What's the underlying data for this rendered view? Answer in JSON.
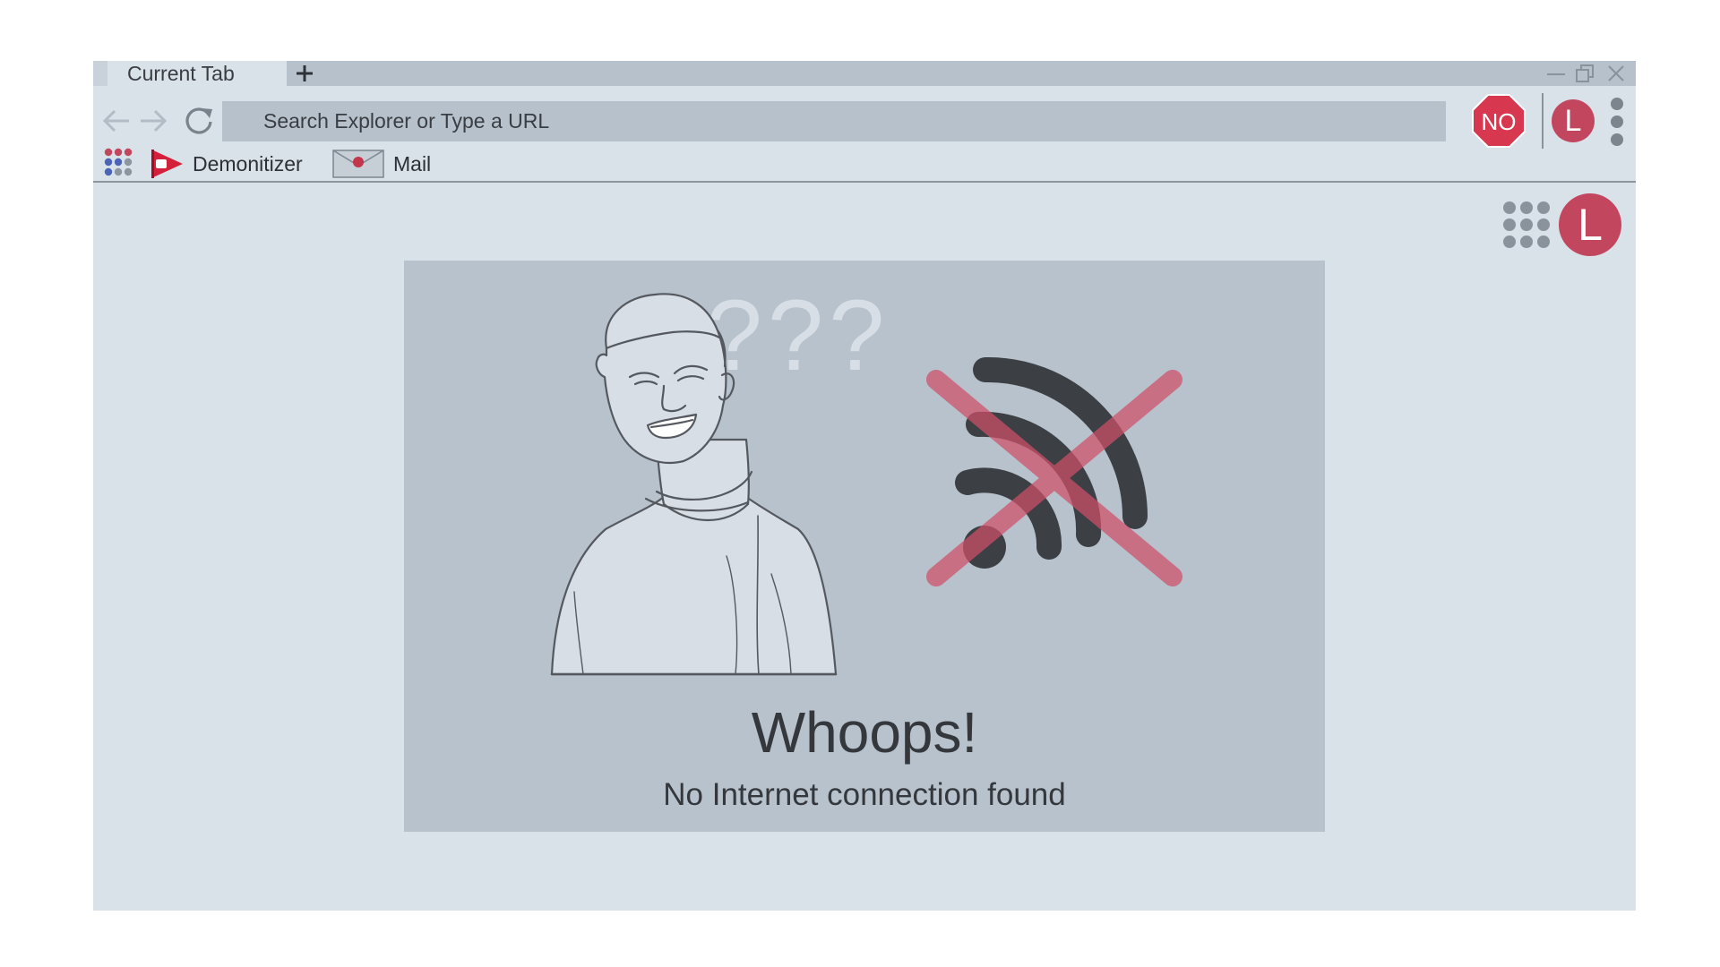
{
  "tabs": [
    {
      "label": "Current Tab",
      "active": true
    }
  ],
  "new_tab_label": "+",
  "toolbar": {
    "address_placeholder": "Search Explorer or Type a URL",
    "extension_badge": "NO",
    "profile_initial": "L"
  },
  "bookmarks": [
    {
      "label": "Demonitizer",
      "icon": "red-flag-play-icon"
    },
    {
      "label": "Mail",
      "icon": "envelope-icon"
    }
  ],
  "page": {
    "profile_initial": "L",
    "question_marks": "???",
    "error_title": "Whoops!",
    "error_message": "No Internet connection found"
  },
  "colors": {
    "browser_bg": "#d9e1e9",
    "chrome_gray": "#b6c1cb",
    "accent_red": "#c2475e",
    "stop_red": "#d8384f",
    "text_dark": "#34373c"
  }
}
